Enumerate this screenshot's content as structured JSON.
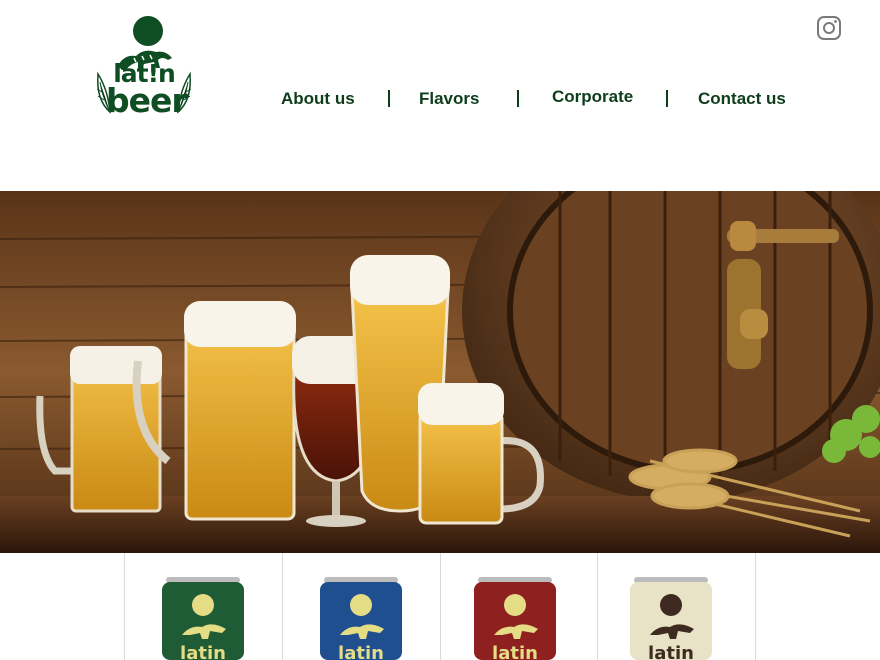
{
  "brand": {
    "logo_line1": "lat!n",
    "logo_line2": "beer"
  },
  "nav": {
    "items": [
      {
        "label": "About us"
      },
      {
        "label": "Flavors"
      },
      {
        "label": "Corporate"
      },
      {
        "label": "Contact us"
      }
    ]
  },
  "social": {
    "icon": "instagram-icon"
  },
  "hero": {
    "icon": "beer-glasses-barrel-photo"
  },
  "products": [
    {
      "color": "#1f5b35",
      "label": "latin"
    },
    {
      "color": "#1f4f8f",
      "label": "latin"
    },
    {
      "color": "#8e2020",
      "label": "latin"
    },
    {
      "color": "#e8e3c6",
      "label": "latin"
    }
  ],
  "colors": {
    "brand_green": "#0f4d22",
    "nav_text": "#0e3d1c"
  }
}
